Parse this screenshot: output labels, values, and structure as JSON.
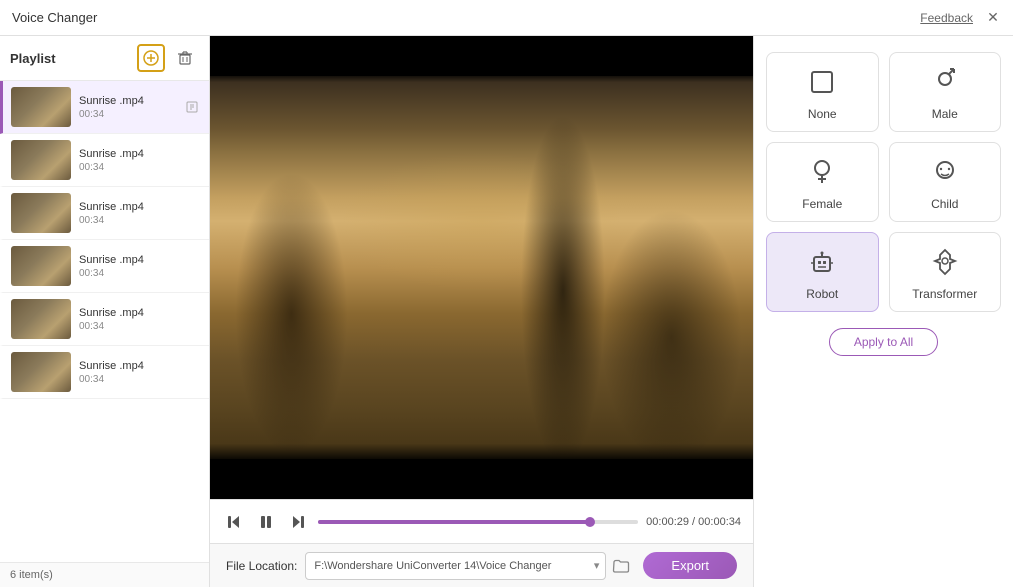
{
  "titleBar": {
    "title": "Voice Changer",
    "feedback": "Feedback",
    "closeIcon": "✕"
  },
  "sidebar": {
    "title": "Playlist",
    "addIcon": "⊕",
    "deleteIcon": "🗑",
    "items": [
      {
        "filename": "Sunrise .mp4",
        "duration": "00:34",
        "active": true
      },
      {
        "filename": "Sunrise .mp4",
        "duration": "00:34",
        "active": false
      },
      {
        "filename": "Sunrise .mp4",
        "duration": "00:34",
        "active": false
      },
      {
        "filename": "Sunrise .mp4",
        "duration": "00:34",
        "active": false
      },
      {
        "filename": "Sunrise .mp4",
        "duration": "00:34",
        "active": false
      },
      {
        "filename": "Sunrise .mp4",
        "duration": "00:34",
        "active": false
      }
    ],
    "itemCount": "6 item(s)"
  },
  "player": {
    "prevIcon": "⏮",
    "pauseIcon": "⏸",
    "nextIcon": "⏭",
    "currentTime": "00:00:29",
    "totalTime": "00:00:34",
    "timeSeparator": " / "
  },
  "bottomBar": {
    "fileLocationLabel": "File Location:",
    "filePath": "F:\\Wondershare UniConverter 14\\Voice Changer",
    "exportLabel": "Export"
  },
  "rightPanel": {
    "voices": [
      {
        "id": "none",
        "label": "None",
        "icon": "none",
        "active": false
      },
      {
        "id": "male",
        "label": "Male",
        "icon": "male",
        "active": false
      },
      {
        "id": "female",
        "label": "Female",
        "icon": "female",
        "active": false
      },
      {
        "id": "child",
        "label": "Child",
        "icon": "child",
        "active": false
      },
      {
        "id": "robot",
        "label": "Robot",
        "icon": "robot",
        "active": true
      },
      {
        "id": "transformer",
        "label": "Transformer",
        "icon": "transformer",
        "active": false
      }
    ],
    "applyAllLabel": "Apply to All"
  }
}
